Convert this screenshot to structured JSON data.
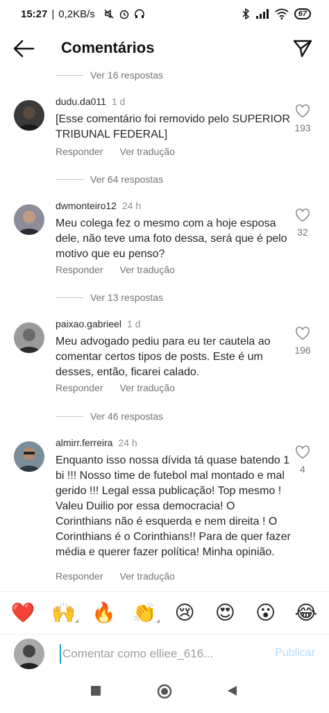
{
  "status_bar": {
    "time": "15:27",
    "speed": "0,2KB/s",
    "battery": "67"
  },
  "header": {
    "title": "Comentários"
  },
  "comments": [
    {
      "replies_label": "Ver 16 respostas",
      "user": "dudu.da011",
      "time": "1 d",
      "text": "[Esse comentário foi removido pelo SUPERIOR TRIBUNAL FEDERAL]",
      "likes": "193",
      "reply_label": "Responder",
      "translate_label": "Ver tradução"
    },
    {
      "replies_label": "Ver 64 respostas",
      "user": "dwmonteiro12",
      "time": "24 h",
      "text": "Meu colega fez o mesmo com a hoje esposa dele, não teve uma foto dessa, será que é pelo motivo que eu penso?",
      "likes": "32",
      "reply_label": "Responder",
      "translate_label": "Ver tradução"
    },
    {
      "replies_label": "Ver 13 respostas",
      "user": "paixao.gabrieel",
      "time": "1 d",
      "text": "Meu advogado pediu para eu ter cautela ao comentar certos tipos de posts. Este é um desses, então, ficarei calado.",
      "likes": "196",
      "reply_label": "Responder",
      "translate_label": "Ver tradução"
    },
    {
      "replies_label": "Ver 46 respostas",
      "user": "almirr.ferreira",
      "time": "24 h",
      "text": "Enquanto isso nossa dívida tá quase batendo 1 bi !!! Nosso time de futebol mal montado  e mal gerido !!! Legal essa publicação! Top mesmo ! Valeu Duilio por essa democracia! O Corinthians não é esquerda e nem direita ! O Corinthians é o Corinthians!! Para de quer fazer média e querer fazer política! Minha opinião.",
      "likes": "4",
      "reply_label": "Responder",
      "translate_label": "Ver tradução"
    }
  ],
  "emojis": [
    "❤️",
    "🙌",
    "🔥",
    "👏",
    "😢",
    "😍",
    "😮",
    "😂"
  ],
  "input": {
    "placeholder": "Comentar como elliee_616...",
    "publish_label": "Publicar"
  }
}
